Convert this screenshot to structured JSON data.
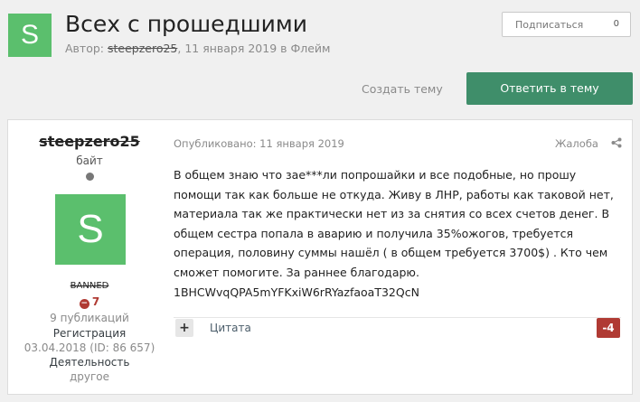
{
  "topic": {
    "avatar_letter": "S",
    "title": "Всех с прошедшими",
    "author_prefix": "Автор: ",
    "author": "steepzero25",
    "date_text": ", 11 января 2019 в ",
    "forum": "Флейм"
  },
  "follow": {
    "label": "Подписаться",
    "count": "0"
  },
  "actions": {
    "create_topic": "Создать тему",
    "reply": "Ответить в тему"
  },
  "post": {
    "author": {
      "username": "steepzero25",
      "title": "байт",
      "avatar_letter": "S",
      "group": "BANNED",
      "reputation": "7",
      "posts": "9 публикаций",
      "reg_label": "Регистрация",
      "reg_date": "03.04.2018 (ID: 86 657)",
      "activity_label": "Деятельность",
      "activity_value": "другое"
    },
    "published": "Опубликовано: 11 января 2019",
    "report": "Жалоба",
    "body": [
      "В общем знаю что зае***ли попрошайки и все подобные, но прошу помощи так как больше не откуда. Живу в ЛНР, работы как таковой нет, материала так же практически нет из за снятия со всех счетов денег. В общем сестра попала в аварию и получила 35%ожогов, требуется операция, половину суммы нашёл ( в общем требуется 3700$) . Кто чем сможет помогите. За раннее благодарю.",
      "1BHCWvqQPA5mYFKxiW6rRYazfaoaT32QcN"
    ],
    "quote": "Цитата",
    "score": "-4"
  },
  "colors": {
    "avatar": "#5bbf6d",
    "reply_button": "#3f8e6a",
    "negative": "#b03a33",
    "background": "#f0f0f0"
  }
}
